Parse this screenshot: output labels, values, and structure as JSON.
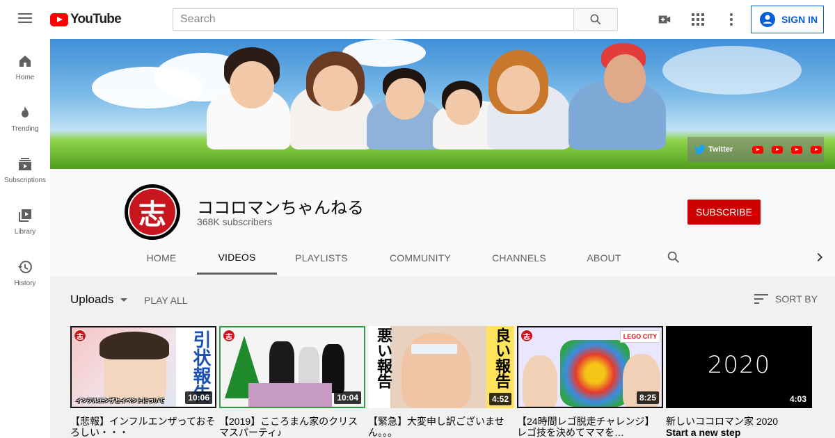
{
  "brand": {
    "logo_text": "YouTube",
    "accent": "#ff0000",
    "link_blue": "#065fd4"
  },
  "search": {
    "placeholder": "Search"
  },
  "topbar": {
    "sign_in_label": "SIGN IN"
  },
  "guide": {
    "items": [
      {
        "label": "Home",
        "icon": "home-icon"
      },
      {
        "label": "Trending",
        "icon": "fire-icon"
      },
      {
        "label": "Subscriptions",
        "icon": "subscriptions-icon"
      },
      {
        "label": "Library",
        "icon": "library-icon"
      },
      {
        "label": "History",
        "icon": "history-icon"
      }
    ]
  },
  "banner": {
    "twitter_label": "Twitter"
  },
  "channel": {
    "name": "ココロマンちゃんねる",
    "subscribers": "368K subscribers",
    "avatar_glyph": "志",
    "subscribe_label": "SUBSCRIBE",
    "subscribe_color": "#cc0000"
  },
  "tabs": [
    {
      "label": "HOME",
      "active": false
    },
    {
      "label": "VIDEOS",
      "active": true
    },
    {
      "label": "PLAYLISTS",
      "active": false
    },
    {
      "label": "COMMUNITY",
      "active": false
    },
    {
      "label": "CHANNELS",
      "active": false
    },
    {
      "label": "ABOUT",
      "active": false
    }
  ],
  "videos_section": {
    "uploads_label": "Uploads",
    "play_all_label": "PLAY ALL",
    "sort_label": "SORT BY"
  },
  "videos": [
    {
      "title": "【悲報】インフルエンザっておそろしい・・・",
      "duration": "10:06",
      "overlay": "引状報告",
      "caption": "インフルエンザとイベントについて"
    },
    {
      "title": "【2019】こころまん家のクリスマスパーティ♪",
      "duration": "10:04"
    },
    {
      "title": "【緊急】大変申し訳ございません。。。",
      "duration": "4:52",
      "overlay_left": "悪い報告",
      "overlay_right": "良い報告"
    },
    {
      "title": "【24時間レゴ脱走チャレンジ】レゴ技を決めてママを…",
      "duration": "8:25",
      "brand_box": "LEGO CITY"
    },
    {
      "title": "新しいココロマン家 2020",
      "subtitle": "Start a new step",
      "duration": "4:03",
      "thumb_text": "2020"
    }
  ]
}
